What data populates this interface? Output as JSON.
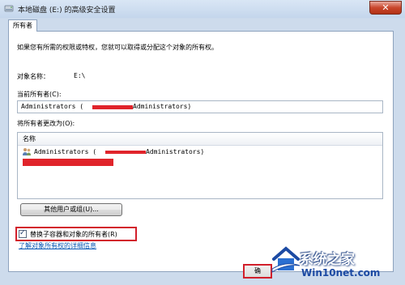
{
  "window": {
    "title": "本地磁盘 (E:) 的高级安全设置"
  },
  "tab": {
    "label": "所有者"
  },
  "description": "如果您有所需的权限或特权，您就可以取得或分配这个对象的所有权。",
  "object": {
    "label": "对象名称：",
    "value": "E:\\"
  },
  "current_owner": {
    "label": "当前所有者(C):",
    "value_prefix": "Administrators (",
    "value_suffix": "Administrators)"
  },
  "change_owner": {
    "label": "将所有者更改为(O):",
    "column_header": "名称",
    "items": [
      {
        "name_prefix": "Administrators (",
        "name_suffix": "Administrators)"
      }
    ]
  },
  "other_users_button": "其他用户或组(U)...",
  "replace_checkbox": {
    "label": "替换子容器和对象的所有者(R)",
    "checked": true
  },
  "help_link": "了解对象所有权的详细信息",
  "ok_button": "确",
  "watermark": {
    "text_cn": "系统之家",
    "text_url": "Win10net.com"
  },
  "colors": {
    "highlight": "#d21f2b",
    "link": "#0a59b5",
    "redaction": "#e0242b"
  }
}
